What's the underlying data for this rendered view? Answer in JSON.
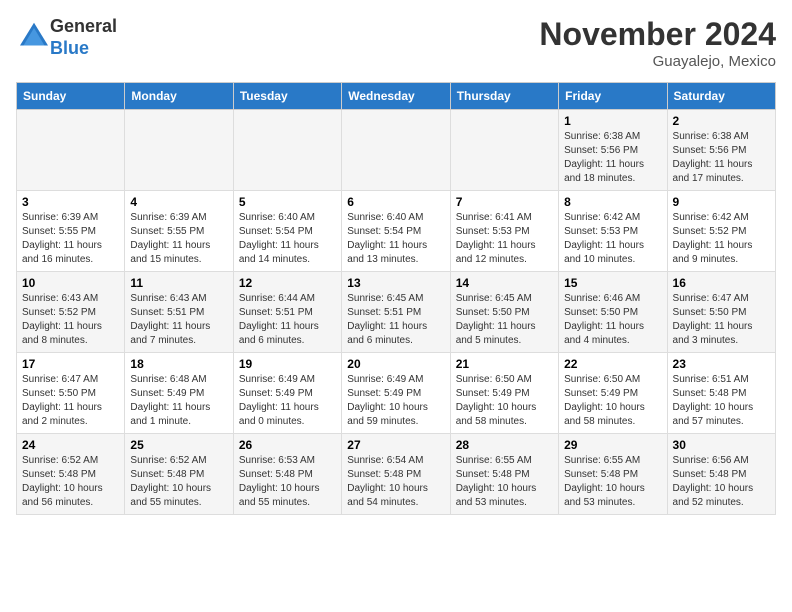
{
  "logo": {
    "general": "General",
    "blue": "Blue"
  },
  "title": "November 2024",
  "location": "Guayalejo, Mexico",
  "weekdays": [
    "Sunday",
    "Monday",
    "Tuesday",
    "Wednesday",
    "Thursday",
    "Friday",
    "Saturday"
  ],
  "weeks": [
    [
      {
        "day": "",
        "info": ""
      },
      {
        "day": "",
        "info": ""
      },
      {
        "day": "",
        "info": ""
      },
      {
        "day": "",
        "info": ""
      },
      {
        "day": "",
        "info": ""
      },
      {
        "day": "1",
        "info": "Sunrise: 6:38 AM\nSunset: 5:56 PM\nDaylight: 11 hours and 18 minutes."
      },
      {
        "day": "2",
        "info": "Sunrise: 6:38 AM\nSunset: 5:56 PM\nDaylight: 11 hours and 17 minutes."
      }
    ],
    [
      {
        "day": "3",
        "info": "Sunrise: 6:39 AM\nSunset: 5:55 PM\nDaylight: 11 hours and 16 minutes."
      },
      {
        "day": "4",
        "info": "Sunrise: 6:39 AM\nSunset: 5:55 PM\nDaylight: 11 hours and 15 minutes."
      },
      {
        "day": "5",
        "info": "Sunrise: 6:40 AM\nSunset: 5:54 PM\nDaylight: 11 hours and 14 minutes."
      },
      {
        "day": "6",
        "info": "Sunrise: 6:40 AM\nSunset: 5:54 PM\nDaylight: 11 hours and 13 minutes."
      },
      {
        "day": "7",
        "info": "Sunrise: 6:41 AM\nSunset: 5:53 PM\nDaylight: 11 hours and 12 minutes."
      },
      {
        "day": "8",
        "info": "Sunrise: 6:42 AM\nSunset: 5:53 PM\nDaylight: 11 hours and 10 minutes."
      },
      {
        "day": "9",
        "info": "Sunrise: 6:42 AM\nSunset: 5:52 PM\nDaylight: 11 hours and 9 minutes."
      }
    ],
    [
      {
        "day": "10",
        "info": "Sunrise: 6:43 AM\nSunset: 5:52 PM\nDaylight: 11 hours and 8 minutes."
      },
      {
        "day": "11",
        "info": "Sunrise: 6:43 AM\nSunset: 5:51 PM\nDaylight: 11 hours and 7 minutes."
      },
      {
        "day": "12",
        "info": "Sunrise: 6:44 AM\nSunset: 5:51 PM\nDaylight: 11 hours and 6 minutes."
      },
      {
        "day": "13",
        "info": "Sunrise: 6:45 AM\nSunset: 5:51 PM\nDaylight: 11 hours and 6 minutes."
      },
      {
        "day": "14",
        "info": "Sunrise: 6:45 AM\nSunset: 5:50 PM\nDaylight: 11 hours and 5 minutes."
      },
      {
        "day": "15",
        "info": "Sunrise: 6:46 AM\nSunset: 5:50 PM\nDaylight: 11 hours and 4 minutes."
      },
      {
        "day": "16",
        "info": "Sunrise: 6:47 AM\nSunset: 5:50 PM\nDaylight: 11 hours and 3 minutes."
      }
    ],
    [
      {
        "day": "17",
        "info": "Sunrise: 6:47 AM\nSunset: 5:50 PM\nDaylight: 11 hours and 2 minutes."
      },
      {
        "day": "18",
        "info": "Sunrise: 6:48 AM\nSunset: 5:49 PM\nDaylight: 11 hours and 1 minute."
      },
      {
        "day": "19",
        "info": "Sunrise: 6:49 AM\nSunset: 5:49 PM\nDaylight: 11 hours and 0 minutes."
      },
      {
        "day": "20",
        "info": "Sunrise: 6:49 AM\nSunset: 5:49 PM\nDaylight: 10 hours and 59 minutes."
      },
      {
        "day": "21",
        "info": "Sunrise: 6:50 AM\nSunset: 5:49 PM\nDaylight: 10 hours and 58 minutes."
      },
      {
        "day": "22",
        "info": "Sunrise: 6:50 AM\nSunset: 5:49 PM\nDaylight: 10 hours and 58 minutes."
      },
      {
        "day": "23",
        "info": "Sunrise: 6:51 AM\nSunset: 5:48 PM\nDaylight: 10 hours and 57 minutes."
      }
    ],
    [
      {
        "day": "24",
        "info": "Sunrise: 6:52 AM\nSunset: 5:48 PM\nDaylight: 10 hours and 56 minutes."
      },
      {
        "day": "25",
        "info": "Sunrise: 6:52 AM\nSunset: 5:48 PM\nDaylight: 10 hours and 55 minutes."
      },
      {
        "day": "26",
        "info": "Sunrise: 6:53 AM\nSunset: 5:48 PM\nDaylight: 10 hours and 55 minutes."
      },
      {
        "day": "27",
        "info": "Sunrise: 6:54 AM\nSunset: 5:48 PM\nDaylight: 10 hours and 54 minutes."
      },
      {
        "day": "28",
        "info": "Sunrise: 6:55 AM\nSunset: 5:48 PM\nDaylight: 10 hours and 53 minutes."
      },
      {
        "day": "29",
        "info": "Sunrise: 6:55 AM\nSunset: 5:48 PM\nDaylight: 10 hours and 53 minutes."
      },
      {
        "day": "30",
        "info": "Sunrise: 6:56 AM\nSunset: 5:48 PM\nDaylight: 10 hours and 52 minutes."
      }
    ]
  ]
}
